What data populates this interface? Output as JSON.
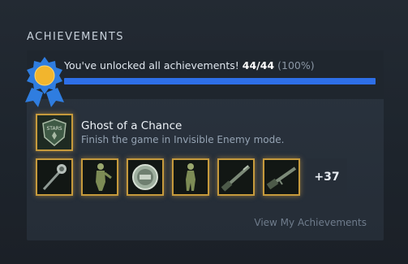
{
  "section": {
    "title": "ACHIEVEMENTS"
  },
  "summary": {
    "text": "You've unlocked all achievements!",
    "count": "44/44",
    "percent": "(100%)",
    "progress_fraction": 1.0,
    "progress_color": "#2e6fe8",
    "badge_icon": "rosette-medal-icon"
  },
  "featured": {
    "name": "Ghost of a Chance",
    "description": "Finish the game in Invisible Enemy mode.",
    "icon": "stars-emblem-icon"
  },
  "thumbnails": [
    {
      "icon": "mace-icon"
    },
    {
      "icon": "figure-icon"
    },
    {
      "icon": "coin-medal-icon"
    },
    {
      "icon": "woman-figure-icon"
    },
    {
      "icon": "shotgun-icon"
    },
    {
      "icon": "rifle-icon"
    }
  ],
  "more_count": "+37",
  "view_link": "View My Achievements",
  "colors": {
    "accent_gold": "#c69a3c",
    "badge_blue": "#2f7de0",
    "badge_gold": "#f2b52d"
  }
}
